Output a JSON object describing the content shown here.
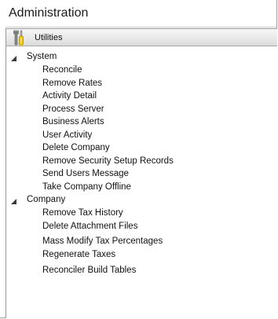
{
  "window": {
    "title": "Administration"
  },
  "panel": {
    "header_label": "Utilities",
    "header_icon": "tools-icon"
  },
  "tree": {
    "groups": [
      {
        "label": "System",
        "expanded": true,
        "items": [
          "Reconcile",
          "Remove Rates",
          "Activity Detail",
          "Process Server",
          "Business Alerts",
          "User Activity",
          "Delete Company",
          "Remove Security Setup Records",
          "Send Users Message",
          "Take Company Offline"
        ]
      },
      {
        "label": "Company",
        "expanded": true,
        "items": [
          "Remove Tax History",
          "Delete Attachment Files",
          "Mass Modify Tax Percentages",
          "Regenerate Taxes",
          "Reconciler Build Tables"
        ]
      }
    ]
  }
}
